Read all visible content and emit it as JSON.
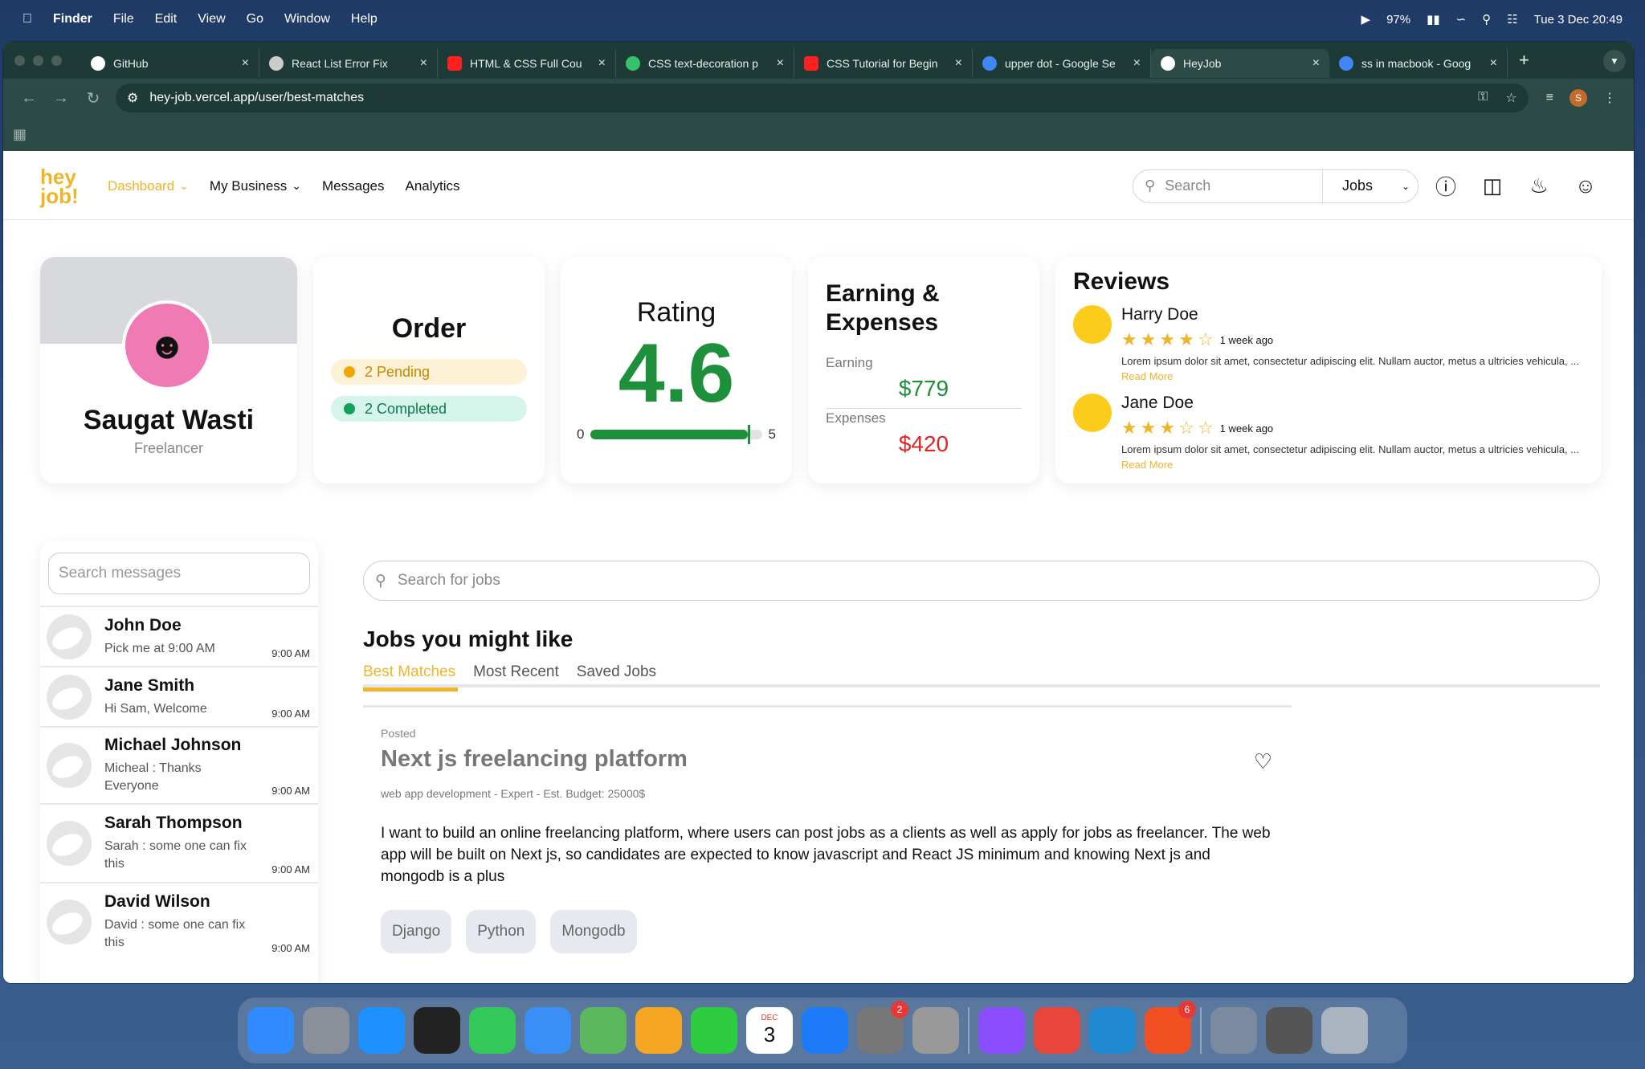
{
  "menubar": {
    "app": "Finder",
    "items": [
      "File",
      "Edit",
      "View",
      "Go",
      "Window",
      "Help"
    ],
    "battery": "97%",
    "datetime": "Tue 3 Dec  20:49"
  },
  "tabs": [
    {
      "title": "GitHub",
      "color": "#ffffff",
      "icon": "github-icon"
    },
    {
      "title": "React List Error Fix",
      "color": "#cccccc",
      "icon": "openai-icon"
    },
    {
      "title": "HTML & CSS Full Cou",
      "color": "#ff2020",
      "icon": "youtube-icon"
    },
    {
      "title": "CSS text-decoration p",
      "color": "#36c26b",
      "icon": "w3schools-icon"
    },
    {
      "title": "CSS Tutorial for Begin",
      "color": "#ff2020",
      "icon": "youtube-icon"
    },
    {
      "title": "upper dot - Google Se",
      "color": "#4285f4",
      "icon": "google-icon"
    },
    {
      "title": "HeyJob",
      "color": "#ffffff",
      "icon": "vercel-icon"
    },
    {
      "title": "ss in macbook - Goog",
      "color": "#4285f4",
      "icon": "google-icon"
    }
  ],
  "address": {
    "url": "hey-job.vercel.app/user/best-matches",
    "profile_initial": "S"
  },
  "nav": {
    "logo_line1": "hey",
    "logo_line2": "job!",
    "items": [
      "Dashboard",
      "My Business",
      "Messages",
      "Analytics"
    ],
    "search_placeholder": "Search",
    "search_scope": "Jobs"
  },
  "profile": {
    "name": "Saugat Wasti",
    "role": "Freelancer"
  },
  "order": {
    "title": "Order",
    "pending": "2 Pending",
    "completed": "2 Completed"
  },
  "rating": {
    "title": "Rating",
    "value": "4.6",
    "min": "0",
    "max": "5",
    "level": 0.92
  },
  "earnings": {
    "title": "Earning & Expenses",
    "earning_label": "Earning",
    "earning": "$779",
    "expenses_label": "Expenses",
    "expenses": "$420"
  },
  "reviews": {
    "title": "Reviews",
    "items": [
      {
        "name": "Harry Doe",
        "stars": 4,
        "ago": "1 week ago",
        "text": "Lorem ipsum dolor sit amet, consectetur adipiscing elit. Nullam auctor, metus a ultricies vehicula, ...",
        "more": "Read More"
      },
      {
        "name": "Jane Doe",
        "stars": 3,
        "ago": "1 week ago",
        "text": "Lorem ipsum dolor sit amet, consectetur adipiscing elit. Nullam auctor, metus a ultricies vehicula, ...",
        "more": "Read More"
      }
    ]
  },
  "messages": {
    "search_placeholder": "Search messages",
    "items": [
      {
        "name": "John Doe",
        "preview": "Pick me at 9:00 AM",
        "time": "9:00 AM"
      },
      {
        "name": "Jane Smith",
        "preview": "Hi Sam, Welcome",
        "time": "9:00 AM"
      },
      {
        "name": "Michael Johnson",
        "preview": "Micheal : Thanks Everyone",
        "time": "9:00 AM"
      },
      {
        "name": "Sarah Thompson",
        "preview": "Sarah : some one can fix this",
        "time": "9:00 AM"
      },
      {
        "name": "David Wilson",
        "preview": "David : some one can fix this",
        "time": "9:00 AM"
      }
    ]
  },
  "jobs": {
    "search_placeholder": "Search for jobs",
    "heading": "Jobs you might like",
    "tabs": [
      "Best Matches",
      "Most Recent",
      "Saved Jobs"
    ],
    "card": {
      "posted": "Posted",
      "title": "Next js freelancing platform",
      "meta": "web app development - Expert - Est. Budget: 25000$",
      "description": "I want to build an online freelancing platform, where users can post jobs as a clients as well as apply for jobs as freelancer. The web app will be built on Next js, so candidates are expected to know javascript and React JS minimum and knowing Next js and mongodb is a plus",
      "skills": [
        "Django",
        "Python",
        "Mongodb"
      ]
    }
  },
  "dock": {
    "apps": [
      {
        "name": "finder",
        "color": "#2f8bff"
      },
      {
        "name": "launchpad",
        "color": "#8a8f9a"
      },
      {
        "name": "safari",
        "color": "#1e90ff"
      },
      {
        "name": "terminal",
        "color": "#222222"
      },
      {
        "name": "messages",
        "color": "#34c759"
      },
      {
        "name": "mail",
        "color": "#3a8ff7"
      },
      {
        "name": "maps",
        "color": "#5cb85c"
      },
      {
        "name": "photos",
        "color": "#f5a623"
      },
      {
        "name": "facetime",
        "color": "#2ecc40"
      },
      {
        "name": "calendar",
        "color": "#ffffff",
        "label": "3",
        "month": "DEC"
      },
      {
        "name": "app-store",
        "color": "#1e7bf7"
      },
      {
        "name": "system-settings",
        "color": "#777777",
        "badge": "2"
      },
      {
        "name": "iphone-mirroring",
        "color": "#999999"
      },
      {
        "name": "messenger",
        "color": "#8a4dff"
      },
      {
        "name": "chrome",
        "color": "#e8453c"
      },
      {
        "name": "vscode",
        "color": "#1f8ad2"
      },
      {
        "name": "microsoft",
        "color": "#f25022",
        "badge": "6"
      },
      {
        "name": "documents",
        "color": "#7a8aa0"
      },
      {
        "name": "screenshots",
        "color": "#555555"
      },
      {
        "name": "trash",
        "color": "#aab4c0"
      }
    ]
  }
}
